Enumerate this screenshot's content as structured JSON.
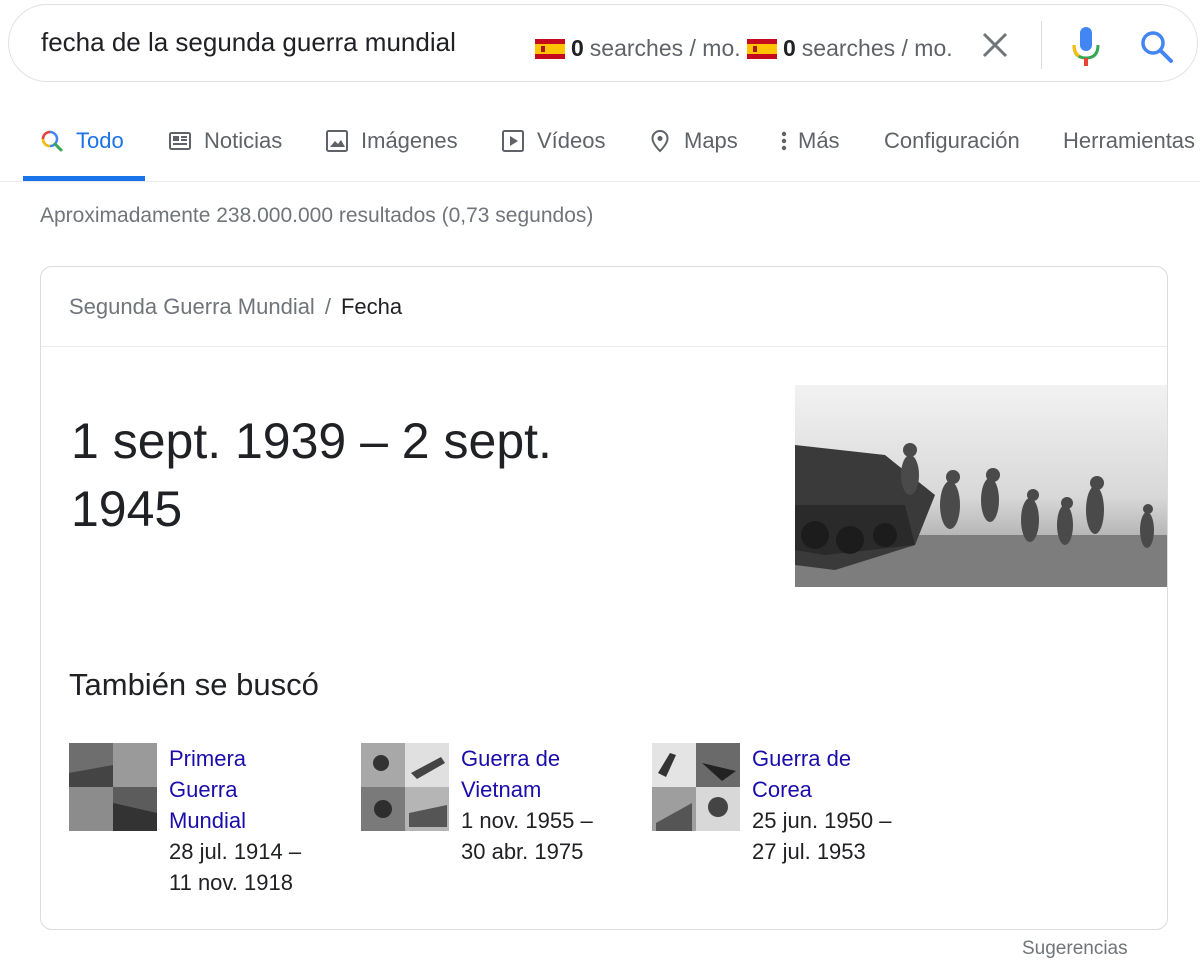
{
  "search": {
    "query": "fecha de la segunda guerra mundial",
    "volume": [
      {
        "count": "0",
        "label": "searches / mo."
      },
      {
        "count": "0",
        "label": "searches / mo."
      }
    ]
  },
  "tabs": [
    {
      "label": "Todo",
      "icon": "search-icon",
      "active": true
    },
    {
      "label": "Noticias",
      "icon": "news-icon"
    },
    {
      "label": "Imágenes",
      "icon": "image-icon"
    },
    {
      "label": "Vídeos",
      "icon": "video-icon"
    },
    {
      "label": "Maps",
      "icon": "map-pin-icon"
    },
    {
      "label": "Más",
      "icon": "more-vert-icon"
    },
    {
      "label": "Configuración"
    },
    {
      "label": "Herramientas"
    }
  ],
  "result_stats": "Aproximadamente 238.000.000 resultados (0,73 segundos)",
  "card": {
    "breadcrumb": {
      "parent": "Segunda Guerra Mundial",
      "separator": "/",
      "current": "Fecha"
    },
    "answer_line1": "1 sept. 1939 – 2 sept.",
    "answer_line2": "1945",
    "also_searched_title": "También se buscó",
    "related": [
      {
        "name_lines": [
          "Primera",
          "Guerra",
          "Mundial"
        ],
        "dates_lines": [
          "28 jul. 1914 –",
          "11 nov. 1918"
        ]
      },
      {
        "name_lines": [
          "Guerra de",
          "Vietnam"
        ],
        "dates_lines": [
          "1 nov. 1955 –",
          "30 abr. 1975"
        ]
      },
      {
        "name_lines": [
          "Guerra de",
          "Corea"
        ],
        "dates_lines": [
          "25 jun. 1950 –",
          "27 jul. 1953"
        ]
      }
    ]
  },
  "footer": {
    "suggestions": "Sugerencias"
  },
  "colors": {
    "accent": "#1a73e8",
    "link": "#1a0dab",
    "muted": "#70757a"
  }
}
